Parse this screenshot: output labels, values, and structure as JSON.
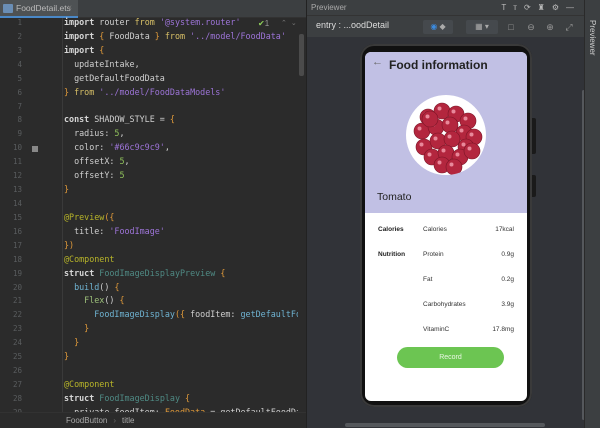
{
  "editor": {
    "tab": "FoodDetail.ets",
    "inspection_count": "1",
    "breadcrumb": [
      "FoodButton",
      "title"
    ],
    "lines": [
      [
        [
          "kw",
          "import"
        ],
        [
          "pr",
          " router "
        ],
        [
          "fr",
          "from"
        ],
        [
          "st",
          " '@system.router'"
        ]
      ],
      [
        [
          "kw",
          "import"
        ],
        [
          "br",
          " {"
        ],
        [
          "pr",
          " FoodData "
        ],
        [
          "br",
          "}"
        ],
        [
          "fr",
          " from"
        ],
        [
          "st",
          " '../model/FoodData'"
        ]
      ],
      [
        [
          "kw",
          "import"
        ],
        [
          "br",
          " {"
        ]
      ],
      [
        [
          "pr",
          "  updateIntake,"
        ]
      ],
      [
        [
          "pr",
          "  getDefaultFoodData"
        ]
      ],
      [
        [
          "br",
          "}"
        ],
        [
          "fr",
          " from"
        ],
        [
          "st",
          " '../model/FoodDataModels'"
        ]
      ],
      [],
      [
        [
          "kw",
          "const"
        ],
        [
          "pr",
          " SHADOW_STYLE = "
        ],
        [
          "br",
          "{"
        ]
      ],
      [
        [
          "pr",
          "  radius: "
        ],
        [
          "nu",
          "5"
        ],
        [
          "pr",
          ","
        ]
      ],
      [
        [
          "pr",
          "  color: "
        ],
        [
          "st",
          "'#66c9c9c9'"
        ],
        [
          "pr",
          ","
        ]
      ],
      [
        [
          "pr",
          "  offsetX: "
        ],
        [
          "nu",
          "5"
        ],
        [
          "pr",
          ","
        ]
      ],
      [
        [
          "pr",
          "  offsetY: "
        ],
        [
          "nu",
          "5"
        ]
      ],
      [
        [
          "br",
          "}"
        ]
      ],
      [],
      [
        [
          "an",
          "@Preview"
        ],
        [
          "br",
          "({"
        ]
      ],
      [
        [
          "pr",
          "  title: "
        ],
        [
          "st",
          "'FoodImage'"
        ]
      ],
      [
        [
          "br",
          "})"
        ]
      ],
      [
        [
          "an",
          "@Component"
        ]
      ],
      [
        [
          "kw",
          "struct"
        ],
        [
          "ty",
          " FoodImageDisplayPreview"
        ],
        [
          "br",
          " {"
        ]
      ],
      [
        [
          "fn",
          "  build"
        ],
        [
          "pr",
          "() "
        ],
        [
          "br",
          "{"
        ]
      ],
      [
        [
          "fx",
          "    Flex"
        ],
        [
          "pr",
          "() "
        ],
        [
          "br",
          "{"
        ]
      ],
      [
        [
          "fn",
          "      FoodImageDisplay"
        ],
        [
          "br",
          "({"
        ],
        [
          "pr",
          " foodItem: "
        ],
        [
          "fn",
          "getDefaultFoodData"
        ]
      ],
      [
        [
          "br",
          "    }"
        ]
      ],
      [
        [
          "br",
          "  }"
        ]
      ],
      [
        [
          "br",
          "}"
        ]
      ],
      [],
      [
        [
          "an",
          "@Component"
        ]
      ],
      [
        [
          "kw",
          "struct"
        ],
        [
          "ty",
          " FoodImageDisplay"
        ],
        [
          "br",
          " {"
        ]
      ],
      [
        [
          "pr",
          "  private foodItem: "
        ],
        [
          "br",
          "FoodData"
        ],
        [
          "pr",
          " = getDefaultFoodData"
        ]
      ]
    ]
  },
  "previewer": {
    "panel_title": "Previewer",
    "target": "entry : ...oodDetail",
    "side_label": "Previewer"
  },
  "app": {
    "title": "Food information",
    "food_name": "Tomato",
    "header_color": "#c1c0e4",
    "rows": [
      {
        "category": "Calories",
        "name": "Calories",
        "value": "17kcal"
      },
      {
        "category": "Nutrition",
        "name": "Protein",
        "value": "0.9g"
      },
      {
        "category": "",
        "name": "Fat",
        "value": "0.2g"
      },
      {
        "category": "",
        "name": "Carbohydrates",
        "value": "3.9g"
      },
      {
        "category": "",
        "name": "VitaminC",
        "value": "17.8mg"
      }
    ],
    "record_label": "Record",
    "record_color": "#6cc552"
  }
}
